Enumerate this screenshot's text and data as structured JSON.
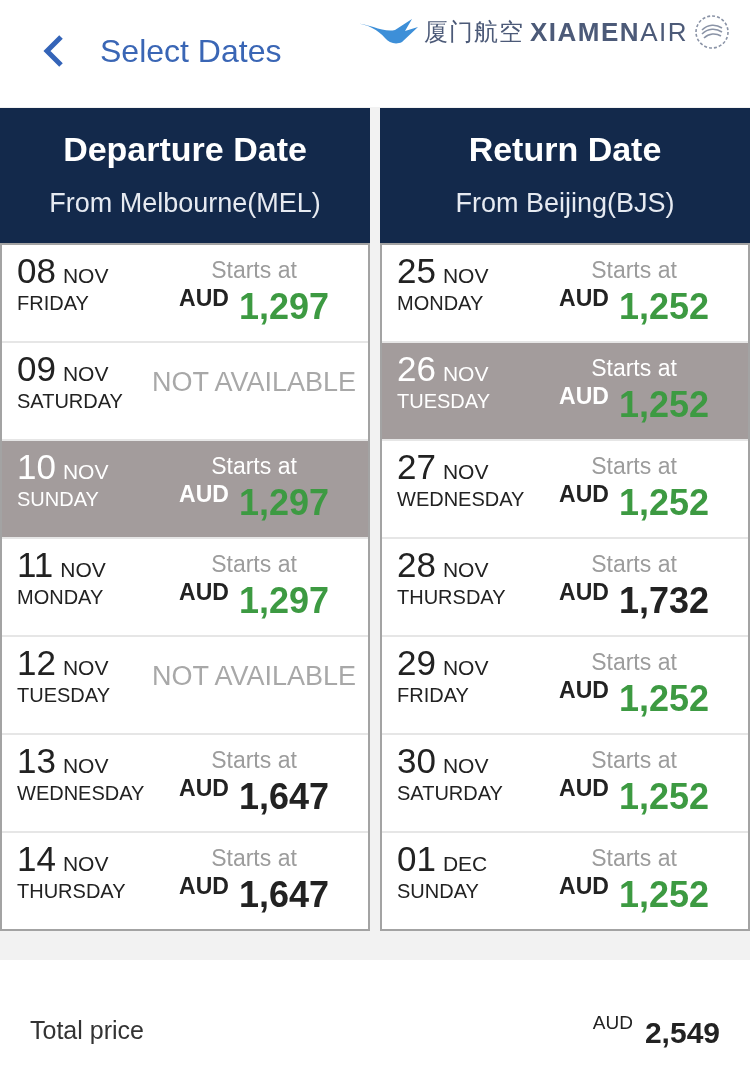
{
  "header": {
    "title": "Select Dates",
    "logo": {
      "chinese": "厦门航空",
      "latin": "**XIAMEN**AIR"
    }
  },
  "columns": [
    {
      "title": "Departure Date",
      "subtitle": "From Melbourne(MEL)",
      "dates": [
        {
          "kind": "fare",
          "day": "08",
          "month": "NOV",
          "weekday": "FRIDAY",
          "selected": false,
          "label": "Starts at",
          "currency": "AUD",
          "price": "1,297",
          "lowest": true
        },
        {
          "kind": "unavailable",
          "day": "09",
          "month": "NOV",
          "weekday": "SATURDAY",
          "selected": false,
          "status": "NOT AVAILABLE"
        },
        {
          "kind": "fare",
          "day": "10",
          "month": "NOV",
          "weekday": "SUNDAY",
          "selected": true,
          "label": "Starts at",
          "currency": "AUD",
          "price": "1,297",
          "lowest": true
        },
        {
          "kind": "fare",
          "day": "11",
          "month": "NOV",
          "weekday": "MONDAY",
          "selected": false,
          "label": "Starts at",
          "currency": "AUD",
          "price": "1,297",
          "lowest": true
        },
        {
          "kind": "unavailable",
          "day": "12",
          "month": "NOV",
          "weekday": "TUESDAY",
          "selected": false,
          "status": "NOT AVAILABLE"
        },
        {
          "kind": "fare",
          "day": "13",
          "month": "NOV",
          "weekday": "WEDNESDAY",
          "selected": false,
          "label": "Starts at",
          "currency": "AUD",
          "price": "1,647",
          "lowest": false
        },
        {
          "kind": "fare",
          "day": "14",
          "month": "NOV",
          "weekday": "THURSDAY",
          "selected": false,
          "label": "Starts at",
          "currency": "AUD",
          "price": "1,647",
          "lowest": false
        }
      ]
    },
    {
      "title": "Return Date",
      "subtitle": "From Beijing(BJS)",
      "dates": [
        {
          "kind": "fare",
          "day": "25",
          "month": "NOV",
          "weekday": "MONDAY",
          "selected": false,
          "label": "Starts at",
          "currency": "AUD",
          "price": "1,252",
          "lowest": true
        },
        {
          "kind": "fare",
          "day": "26",
          "month": "NOV",
          "weekday": "TUESDAY",
          "selected": true,
          "label": "Starts at",
          "currency": "AUD",
          "price": "1,252",
          "lowest": true
        },
        {
          "kind": "fare",
          "day": "27",
          "month": "NOV",
          "weekday": "WEDNESDAY",
          "selected": false,
          "label": "Starts at",
          "currency": "AUD",
          "price": "1,252",
          "lowest": true
        },
        {
          "kind": "fare",
          "day": "28",
          "month": "NOV",
          "weekday": "THURSDAY",
          "selected": false,
          "label": "Starts at",
          "currency": "AUD",
          "price": "1,732",
          "lowest": false
        },
        {
          "kind": "fare",
          "day": "29",
          "month": "NOV",
          "weekday": "FRIDAY",
          "selected": false,
          "label": "Starts at",
          "currency": "AUD",
          "price": "1,252",
          "lowest": true
        },
        {
          "kind": "fare",
          "day": "30",
          "month": "NOV",
          "weekday": "SATURDAY",
          "selected": false,
          "label": "Starts at",
          "currency": "AUD",
          "price": "1,252",
          "lowest": true
        },
        {
          "kind": "fare",
          "day": "01",
          "month": "DEC",
          "weekday": "SUNDAY",
          "selected": false,
          "label": "Starts at",
          "currency": "AUD",
          "price": "1,252",
          "lowest": true
        }
      ]
    }
  ],
  "total": {
    "label": "Total price",
    "currency": "AUD",
    "amount": "2,549"
  }
}
